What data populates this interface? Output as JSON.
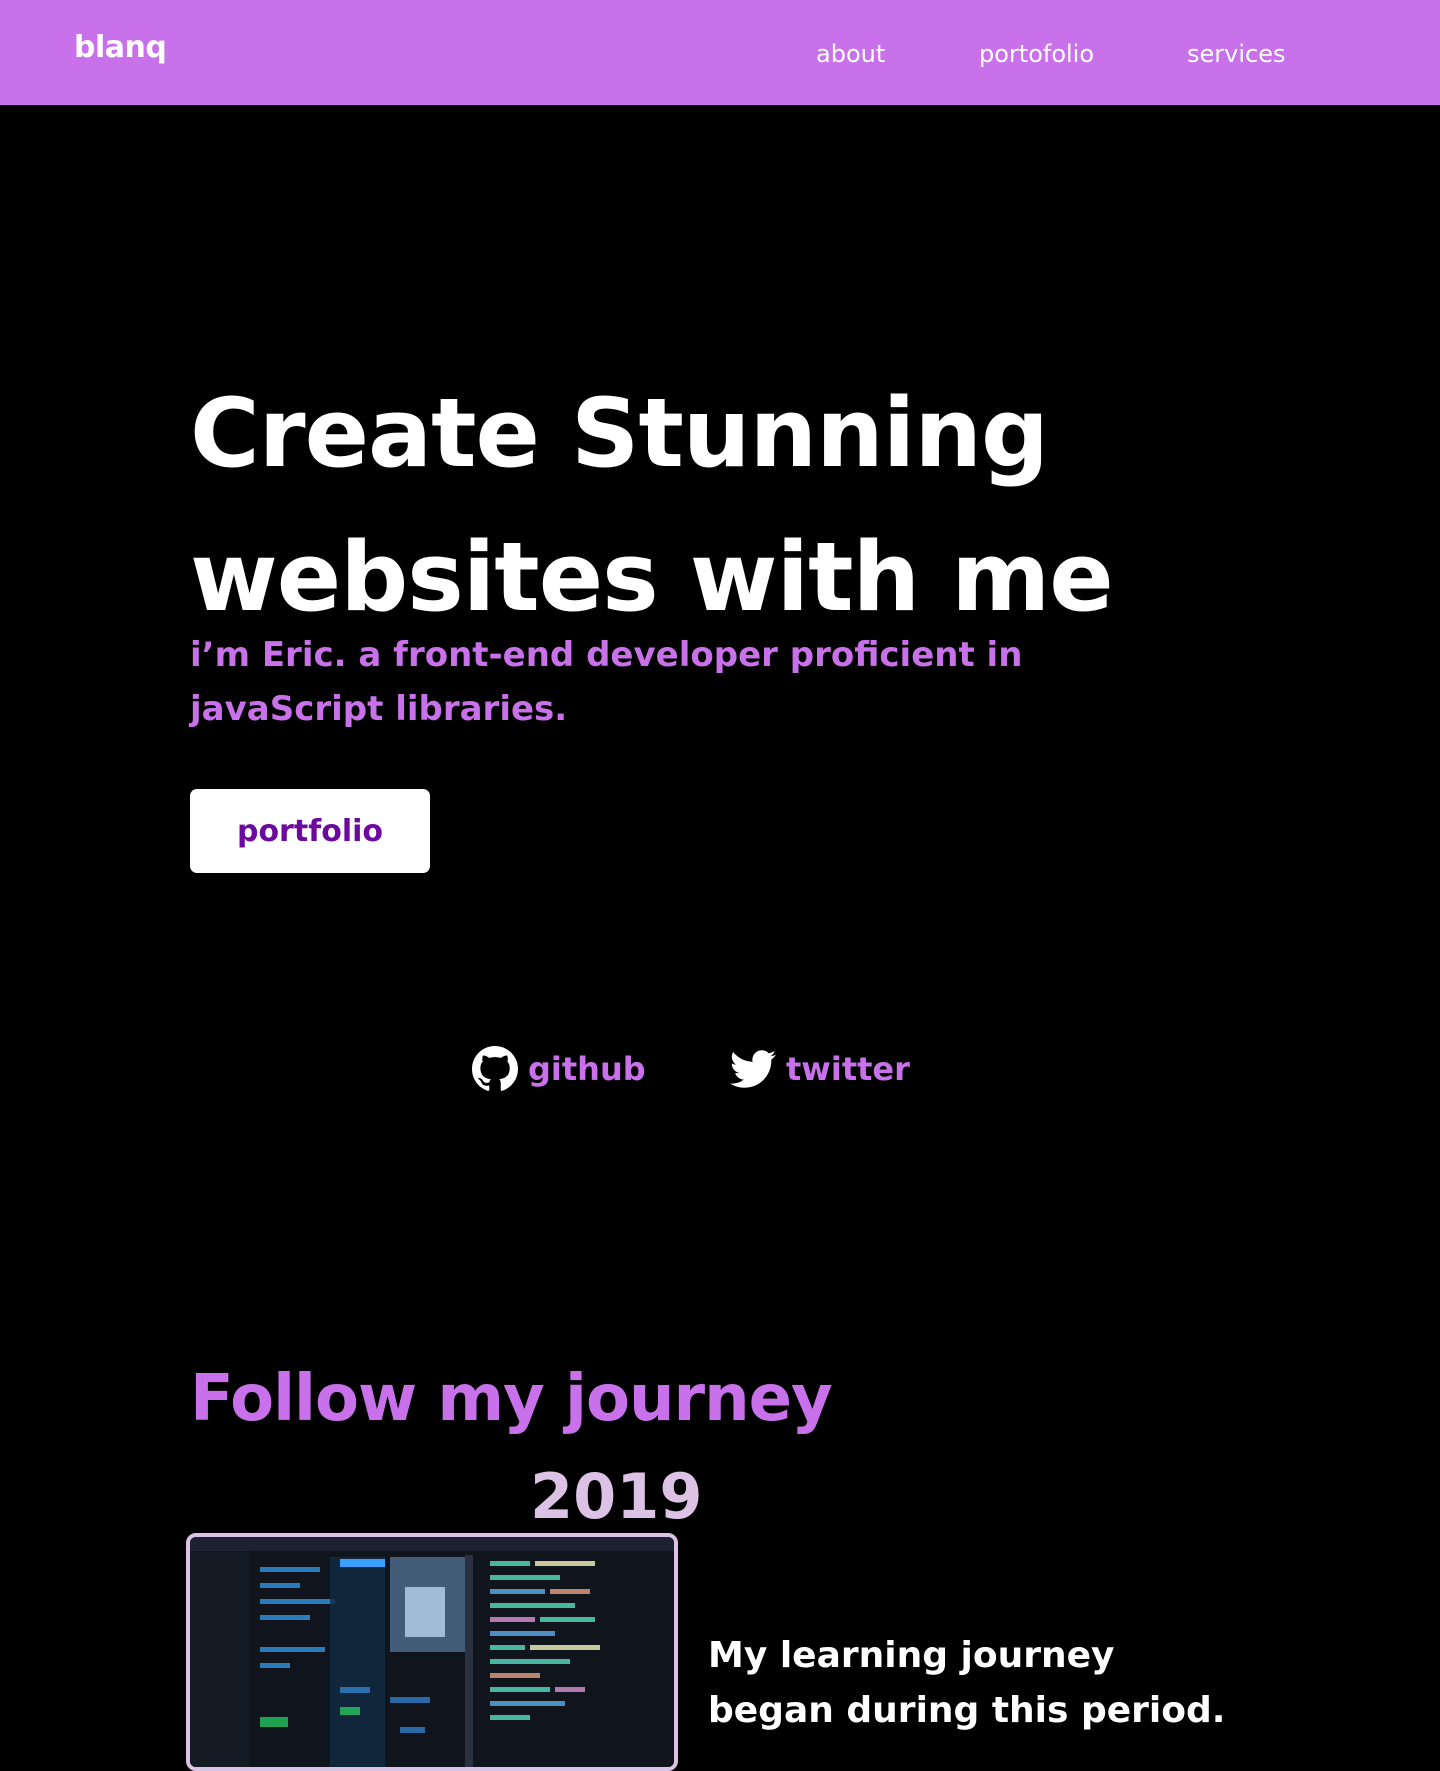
{
  "nav": {
    "logo": "blanq",
    "links": [
      "about",
      "portofolio",
      "services"
    ]
  },
  "hero": {
    "title_line1": "Create Stunning",
    "title_line2": "websites with me",
    "subtitle": "i’m Eric. a front-end developer proficient in javaScript libraries.",
    "button_label": "portfolio"
  },
  "social": {
    "github": {
      "label": "github",
      "icon": "github-icon"
    },
    "twitter": {
      "label": "twitter",
      "icon": "twitter-bird-icon"
    }
  },
  "journey": {
    "title": "Follow my journey",
    "entries": [
      {
        "year": "2019",
        "text": "My learning journey began during this period."
      }
    ]
  },
  "colors": {
    "accent": "#c871ea",
    "button_text": "#6b0a9c",
    "year": "#dcc3e6",
    "background": "#000000"
  }
}
